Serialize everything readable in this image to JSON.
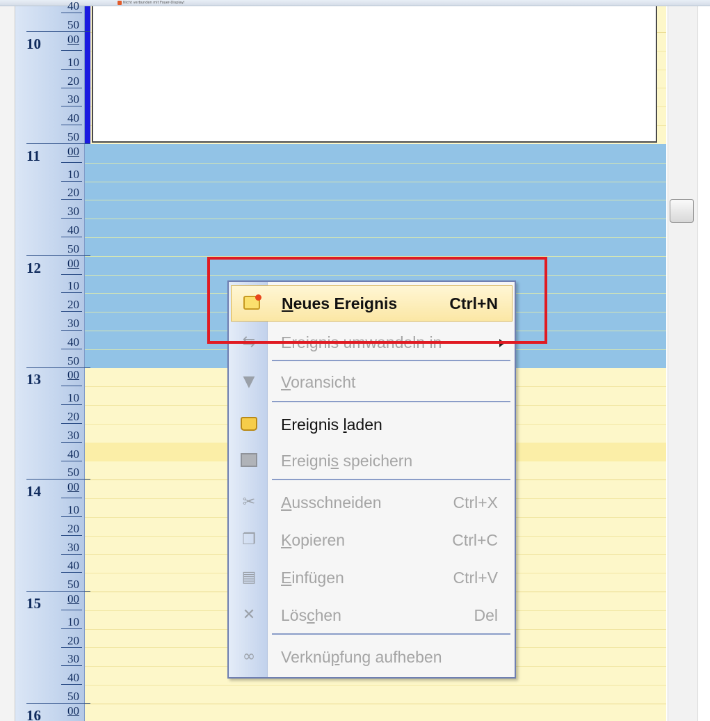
{
  "top_bar": {
    "status_text": "Nicht verbunden mit Foyer-Display!"
  },
  "ruler": {
    "top_partial_label": "40",
    "rows": [
      {
        "type": "min",
        "label": "50"
      },
      {
        "type": "hour",
        "hour": "10",
        "label": "00"
      },
      {
        "type": "min",
        "label": "10"
      },
      {
        "type": "min",
        "label": "20"
      },
      {
        "type": "min",
        "label": "30"
      },
      {
        "type": "min",
        "label": "40"
      },
      {
        "type": "min",
        "label": "50"
      },
      {
        "type": "hour",
        "hour": "11",
        "label": "00"
      },
      {
        "type": "min",
        "label": "10"
      },
      {
        "type": "min",
        "label": "20"
      },
      {
        "type": "min",
        "label": "30"
      },
      {
        "type": "min",
        "label": "40"
      },
      {
        "type": "min",
        "label": "50"
      },
      {
        "type": "hour",
        "hour": "12",
        "label": "00"
      },
      {
        "type": "min",
        "label": "10"
      },
      {
        "type": "min",
        "label": "20"
      },
      {
        "type": "min",
        "label": "30"
      },
      {
        "type": "min",
        "label": "40"
      },
      {
        "type": "min",
        "label": "50"
      },
      {
        "type": "hour",
        "hour": "13",
        "label": "00"
      },
      {
        "type": "min",
        "label": "10"
      },
      {
        "type": "min",
        "label": "20"
      },
      {
        "type": "min",
        "label": "30"
      },
      {
        "type": "min",
        "label": "40"
      },
      {
        "type": "min",
        "label": "50"
      },
      {
        "type": "hour",
        "hour": "14",
        "label": "00"
      },
      {
        "type": "min",
        "label": "10"
      },
      {
        "type": "min",
        "label": "20"
      },
      {
        "type": "min",
        "label": "30"
      },
      {
        "type": "min",
        "label": "40"
      },
      {
        "type": "min",
        "label": "50"
      },
      {
        "type": "hour",
        "hour": "15",
        "label": "00"
      },
      {
        "type": "min",
        "label": "10"
      },
      {
        "type": "min",
        "label": "20"
      },
      {
        "type": "min",
        "label": "30"
      },
      {
        "type": "min",
        "label": "40"
      },
      {
        "type": "min",
        "label": "50"
      },
      {
        "type": "hour",
        "hour": "16",
        "label": "00"
      }
    ]
  },
  "context_menu": {
    "items": [
      {
        "label": "Neues Ereignis",
        "mnemonic": "N",
        "shortcut": "Ctrl+N",
        "enabled": true,
        "hot": true,
        "icon": "new-event-icon"
      },
      {
        "label": "Ereignis umwandeln in",
        "shortcut": "",
        "enabled": false,
        "submenu": true,
        "icon": "convert-icon"
      },
      {
        "separator": true
      },
      {
        "label": "Voransicht",
        "mnemonic": "V",
        "shortcut": "",
        "enabled": false,
        "icon": "preview-icon"
      },
      {
        "separator": true
      },
      {
        "label": "Ereignis laden",
        "mnemonic": "l",
        "shortcut": "",
        "enabled": true,
        "icon": "folder-icon"
      },
      {
        "label": "Ereignis speichern",
        "mnemonic": "s",
        "shortcut": "",
        "enabled": false,
        "icon": "save-icon"
      },
      {
        "separator": true
      },
      {
        "label": "Ausschneiden",
        "mnemonic": "A",
        "shortcut": "Ctrl+X",
        "enabled": false,
        "icon": "scissors-icon"
      },
      {
        "label": "Kopieren",
        "mnemonic": "K",
        "shortcut": "Ctrl+C",
        "enabled": false,
        "icon": "copy-icon"
      },
      {
        "label": "Einfügen",
        "mnemonic": "E",
        "shortcut": "Ctrl+V",
        "enabled": false,
        "icon": "paste-icon"
      },
      {
        "label": "Löschen",
        "mnemonic": "c",
        "shortcut": "Del",
        "enabled": false,
        "icon": "delete-icon"
      },
      {
        "separator": true
      },
      {
        "label": "Verknüpfung aufheben",
        "mnemonic": "p",
        "shortcut": "",
        "enabled": false,
        "icon": "unlink-icon"
      }
    ]
  },
  "colors": {
    "selection": "#92c3e6",
    "calendar_bg": "#fdf7c9",
    "event_marker": "#1a1ae0",
    "annotation_frame": "#e01b23"
  }
}
